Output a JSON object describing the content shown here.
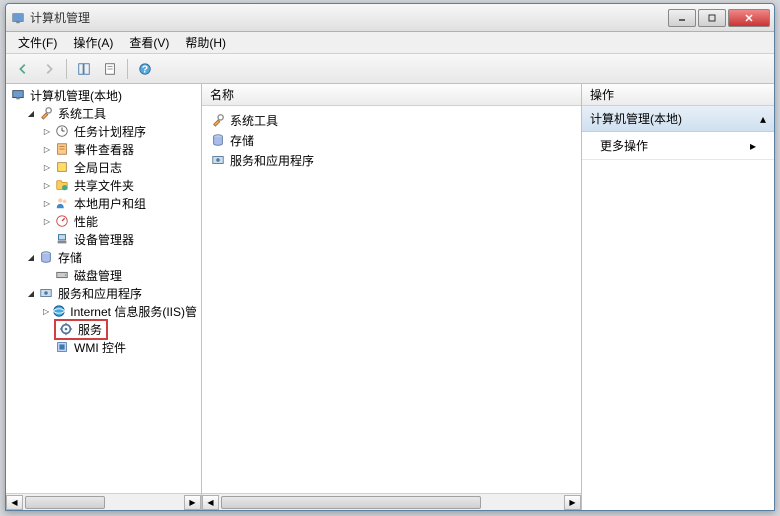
{
  "window": {
    "title": "计算机管理"
  },
  "menubar": {
    "file": "文件(F)",
    "action": "操作(A)",
    "view": "查看(V)",
    "help": "帮助(H)"
  },
  "tree": {
    "root": "计算机管理(本地)",
    "system_tools": "系统工具",
    "task_scheduler": "任务计划程序",
    "event_viewer": "事件查看器",
    "global_log": "全局日志",
    "shared_folders": "共享文件夹",
    "local_users": "本地用户和组",
    "performance": "性能",
    "device_manager": "设备管理器",
    "storage": "存储",
    "disk_mgmt": "磁盘管理",
    "services_apps": "服务和应用程序",
    "iis": "Internet 信息服务(IIS)管",
    "services": "服务",
    "wmi": "WMI 控件"
  },
  "list": {
    "header_name": "名称",
    "items": {
      "system_tools": "系统工具",
      "storage": "存储",
      "services_apps": "服务和应用程序"
    }
  },
  "actions": {
    "header": "操作",
    "section_title": "计算机管理(本地)",
    "more_actions": "更多操作"
  }
}
